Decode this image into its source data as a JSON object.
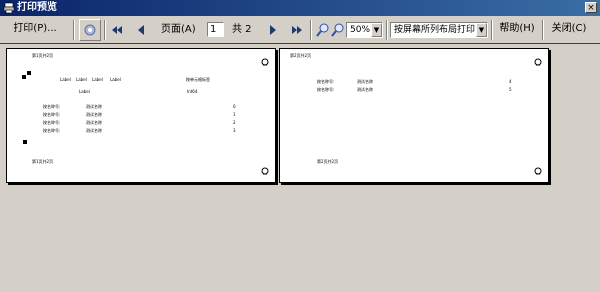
{
  "window": {
    "title": "打印预览",
    "close_glyph": "×"
  },
  "toolbar": {
    "print_label": "打印(P)...",
    "page_label": "页面(A)",
    "page_value": "1",
    "total_label": "共 2",
    "zoom_value": "50%",
    "layout_value": "按屏幕所列布局打印",
    "help_label": "帮助(H)",
    "close_label": "关闭(C)"
  },
  "page1": {
    "header": "第1页共2页",
    "footer": "第1页共2页",
    "col_headers": [
      "Label",
      "Label",
      "Label",
      "Label"
    ],
    "sub_label": "Label",
    "right_title": "按单元格标签",
    "right_value": "Int64",
    "rows": [
      {
        "name": "按名称号:",
        "value": "测试名称",
        "num": "0"
      },
      {
        "name": "按名称号:",
        "value": "测试名称",
        "num": "1"
      },
      {
        "name": "按名称号:",
        "value": "测试名称",
        "num": "2"
      },
      {
        "name": "按名称号:",
        "value": "测试名称",
        "num": "3"
      }
    ]
  },
  "page2": {
    "header": "第2页共2页",
    "footer": "第2页共2页",
    "rows": [
      {
        "name": "按名称号:",
        "value": "测试名称",
        "num": "4"
      },
      {
        "name": "按名称号:",
        "value": "测试名称",
        "num": "5"
      }
    ]
  }
}
